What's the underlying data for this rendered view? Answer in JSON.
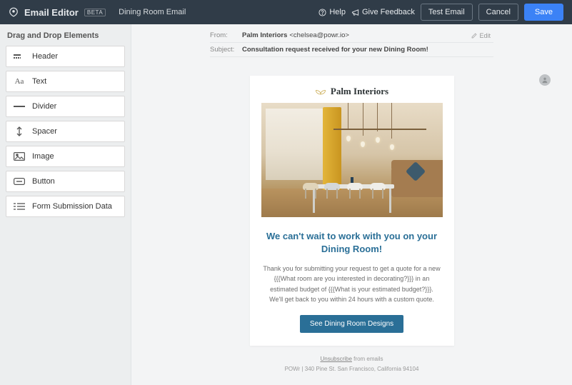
{
  "topbar": {
    "app_name": "Email Editor",
    "beta_tag": "BETA",
    "document_name": "Dining Room Email",
    "help_label": "Help",
    "feedback_label": "Give Feedback",
    "test_email_label": "Test Email",
    "cancel_label": "Cancel",
    "save_label": "Save"
  },
  "sidebar": {
    "title": "Drag and Drop Elements",
    "items": [
      {
        "label": "Header",
        "icon": "header-icon"
      },
      {
        "label": "Text",
        "icon": "text-icon"
      },
      {
        "label": "Divider",
        "icon": "divider-icon"
      },
      {
        "label": "Spacer",
        "icon": "spacer-icon"
      },
      {
        "label": "Image",
        "icon": "image-icon"
      },
      {
        "label": "Button",
        "icon": "button-icon"
      },
      {
        "label": "Form Submission Data",
        "icon": "form-data-icon"
      }
    ]
  },
  "meta": {
    "from_label": "From:",
    "from_name": "Palm Interiors",
    "from_email": "<chelsea@powr.io>",
    "subject_label": "Subject:",
    "subject_value": "Consultation request received for your new Dining Room!",
    "edit_label": "Edit"
  },
  "email": {
    "brand_name": "Palm Interiors",
    "headline": "We can't wait to work with you on your Dining Room!",
    "body_text": "Thank you for submitting your request to get a quote for a new {{{What room are you interested in decorating?}}} in an estimated budget of {{{What is your estimated budget?}}}. We'll get back to you within 24 hours with a custom quote.",
    "cta_label": "See Dining Room Designs"
  },
  "footer": {
    "unsubscribe_link": "Unsubscribe",
    "unsubscribe_tail": " from emails",
    "address": "POWr | 340 Pine St. San Francisco, California 94104"
  }
}
